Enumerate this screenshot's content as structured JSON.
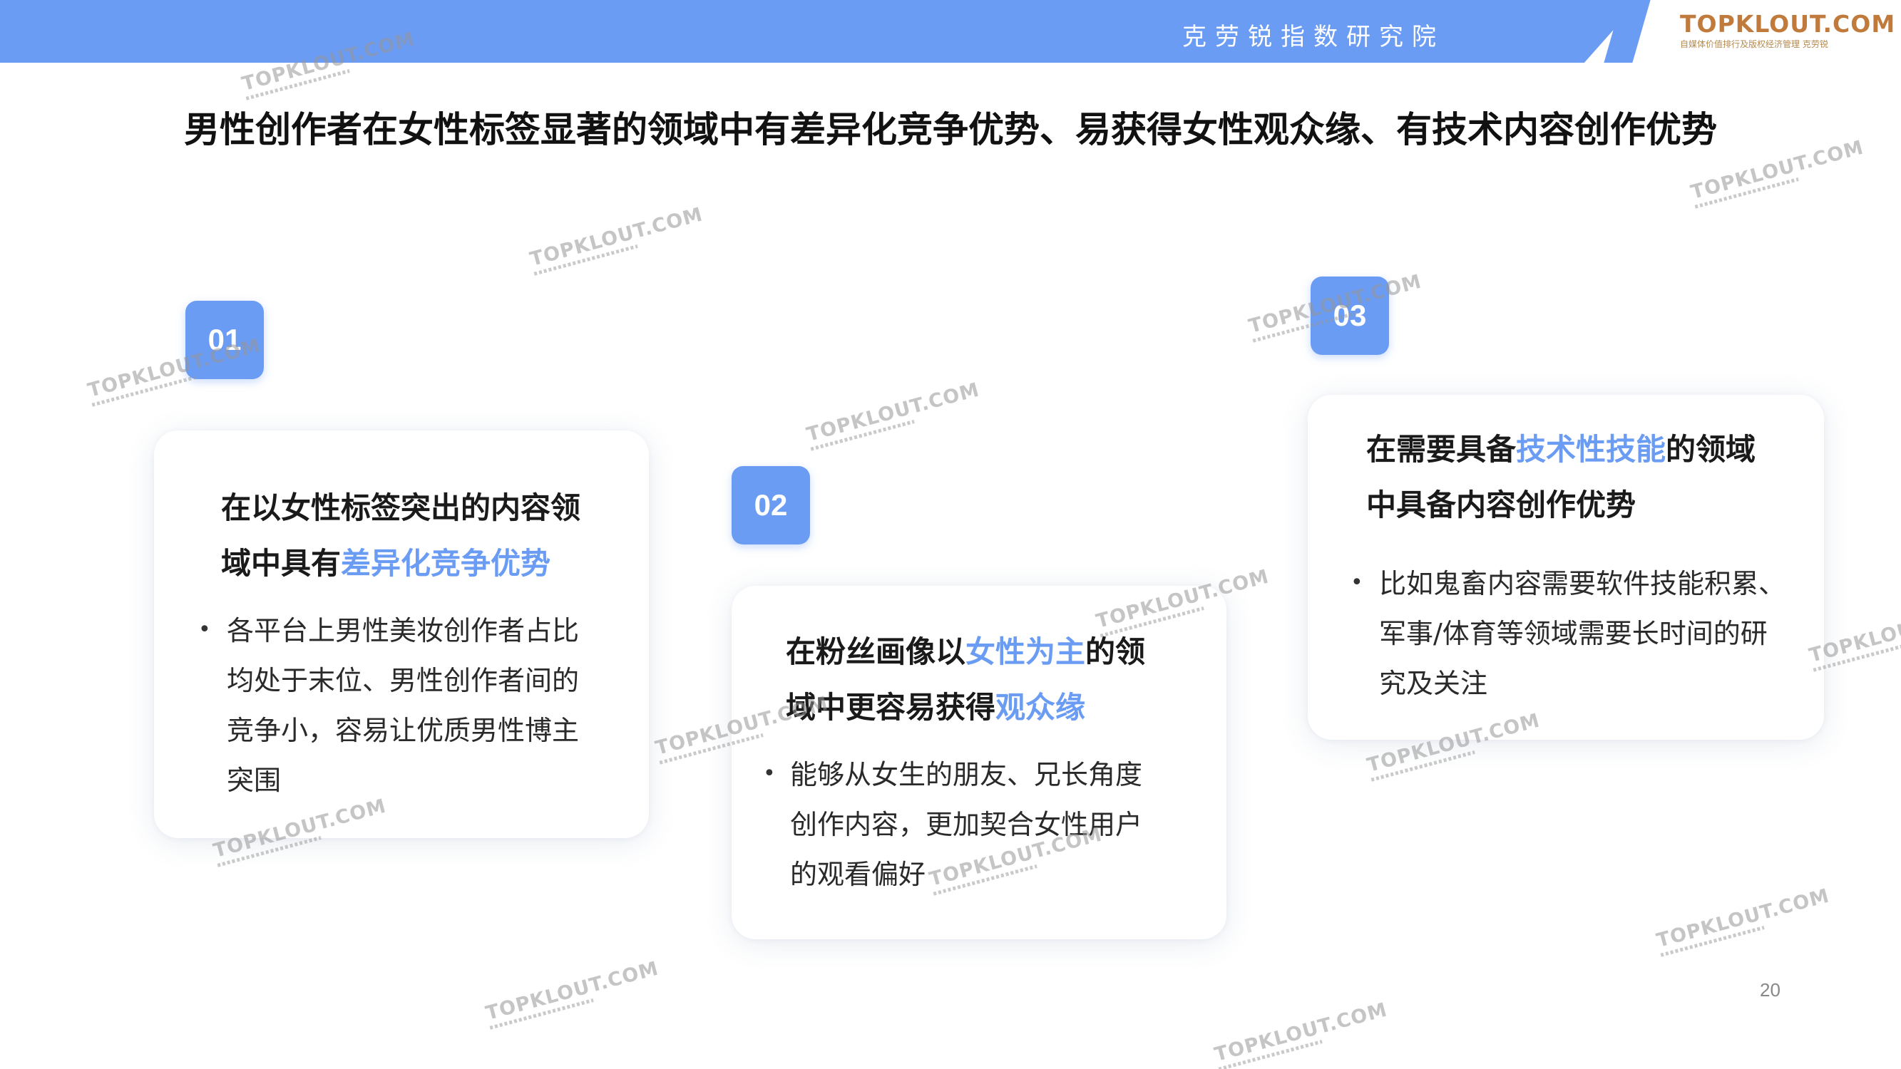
{
  "header": {
    "title": "克劳锐指数研究院",
    "logo_text": "TOPKLOUT.COM",
    "logo_subtitle": "自媒体价值排行及版权经济管理 克劳锐",
    "accent_color": "#6b9cf4"
  },
  "main_title": "男性创作者在女性标签显著的领域中有差异化竞争优势、易获得女性观众缘、有技术内容创作优势",
  "cards": [
    {
      "number": "01",
      "heading_line1": "在以女性标签突出的内容领",
      "heading_line2_prefix": "域中具有",
      "heading_line2_highlight": "差异化竞争优势",
      "bullet_lines": [
        "各平台上男性美妆创作者占比",
        "均处于末位、男性创作者间的",
        "竞争小，容易让优质男性博主",
        "突围"
      ]
    },
    {
      "number": "02",
      "heading_line1_prefix": "在粉丝画像以",
      "heading_line1_highlight": "女性为主",
      "heading_line1_suffix": "的领",
      "heading_line2_prefix": "域中更容易获得",
      "heading_line2_highlight": "观众缘",
      "bullet_lines": [
        "能够从女生的朋友、兄长角度",
        "创作内容，更加契合女性用户",
        "的观看偏好"
      ]
    },
    {
      "number": "03",
      "heading_line1_prefix": "在需要具备",
      "heading_line1_highlight": "技术性技能",
      "heading_line1_suffix": "的领域",
      "heading_line2": "中具备内容创作优势",
      "bullet_lines": [
        "比如鬼畜内容需要软件技能积累、",
        "军事/体育等领域需要长时间的研",
        "究及关注"
      ]
    }
  ],
  "bullet_symbol": "•",
  "page_number": "20",
  "watermark_text": "TOPKLOUT.COM"
}
